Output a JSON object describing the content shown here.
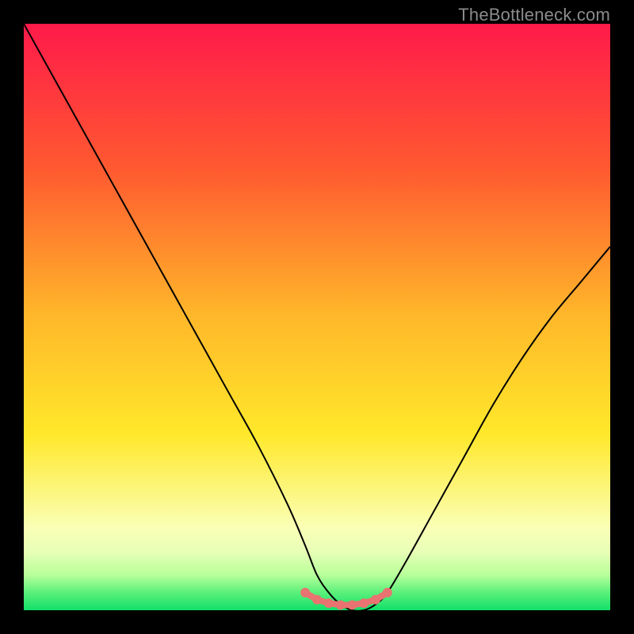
{
  "watermark": "TheBottleneck.com",
  "colors": {
    "frame": "#000000",
    "curve": "#000000",
    "dots": "#e87371",
    "gradient_top": "#ff1a4a",
    "gradient_mid_upper": "#ff8a2a",
    "gradient_mid": "#ffe82a",
    "gradient_low": "#f8ffb0",
    "gradient_bottom": "#11e06a"
  },
  "chart_data": {
    "type": "line",
    "title": "",
    "xlabel": "",
    "ylabel": "",
    "xlim": [
      0,
      100
    ],
    "ylim": [
      0,
      100
    ],
    "series": [
      {
        "name": "bottleneck-curve",
        "x": [
          0,
          5,
          10,
          15,
          20,
          25,
          30,
          35,
          40,
          45,
          48,
          50,
          52,
          54,
          56,
          58,
          60,
          62,
          65,
          70,
          75,
          80,
          85,
          90,
          95,
          100
        ],
        "y": [
          100,
          91,
          82,
          73,
          64,
          55,
          46,
          37,
          28,
          18,
          11,
          6,
          3,
          1,
          0,
          0,
          1,
          3,
          8,
          17,
          26,
          35,
          43,
          50,
          56,
          62
        ]
      }
    ],
    "flat_segment_dots": {
      "name": "optimal-range",
      "x": [
        48,
        50,
        52,
        54,
        56,
        58,
        60,
        62
      ],
      "y": [
        3,
        1.8,
        1.2,
        0.9,
        0.9,
        1.2,
        1.8,
        3
      ]
    },
    "background_gradient_stops": [
      {
        "pos": 0.0,
        "color": "#ff1a4a"
      },
      {
        "pos": 0.25,
        "color": "#ff5a30"
      },
      {
        "pos": 0.5,
        "color": "#ffb82a"
      },
      {
        "pos": 0.7,
        "color": "#ffe82a"
      },
      {
        "pos": 0.86,
        "color": "#faffb6"
      },
      {
        "pos": 0.9,
        "color": "#e8ffb6"
      },
      {
        "pos": 0.94,
        "color": "#b8ff9a"
      },
      {
        "pos": 0.97,
        "color": "#5af07a"
      },
      {
        "pos": 1.0,
        "color": "#11e06a"
      }
    ]
  }
}
